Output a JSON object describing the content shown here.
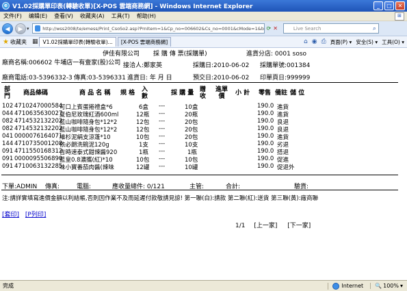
{
  "window": {
    "title": "V1.02採購單印表(轉驗收單)[X-POS 雲端商務網] - Windows Internet Explorer",
    "minimize": "_",
    "maximize": "□",
    "close": "✕"
  },
  "menu": [
    "文件(F)",
    "编辑(E)",
    "查看(V)",
    "收藏夹(A)",
    "工具(T)",
    "帮助(H)"
  ],
  "address": {
    "url": "http://wss2008/te/emess/Print_CsoSo2.asp?PrnItem=1&Cp_no=006602&Cs_no=0001&cMode=1&bk18",
    "search_placeholder": "Live Search"
  },
  "favorites": {
    "label": "收藏夹",
    "tabs": [
      "V1.02採購單印表(轉驗收單)...",
      "[X-POS 雲端商務網]"
    ],
    "tools": [
      "頁面(P) ▾",
      "安全(S) ▾",
      "工具(O) ▾"
    ]
  },
  "doc": {
    "company": "伊佳有限公司",
    "doc_title": "採 購 傳 票(採購單)",
    "branch": "進貨分店: 0001 soso",
    "supplier": "廠商名稱:006602 牛埔店一有壹家(股)公司",
    "contact": "接洽人:鄭家英",
    "order_date": "採購日:2010-06-02",
    "order_no": "採購單號:001384",
    "phone": "廠商電話:03-5396332-3",
    "fax": "傳真:03-5396331",
    "delivery": "進貨日:   年   月   日",
    "eta": "預交日:2010-06-02",
    "print_count": "印單頁日:999999",
    "headers": {
      "dept": "部門",
      "barcode": "商品條碼",
      "name": "商 品 名 稱",
      "spec": "規 格",
      "in_qty": "入數",
      "order_qty": "採 購 量",
      "gift": "贈收",
      "price": "進單價",
      "subtotal": "小 計",
      "retail": "零售",
      "remark": "備註",
      "storage": "儲 位"
    },
    "rows": [
      {
        "dept": "102",
        "barcode": "4710247000584",
        "name": "可口上賓蛋捲禮盒*6",
        "in": "6盒",
        "dash": "---",
        "qty": "10盒",
        "retail": "190.0",
        "remark": "進貨"
      },
      {
        "dept": "044",
        "barcode": "4710635630027",
        "name": "夏伯尼玫瑰紅酒600ml",
        "in": "12瓶",
        "dash": "---",
        "qty": "20瓶",
        "retail": "190.0",
        "remark": "進貨"
      },
      {
        "dept": "082",
        "barcode": "4714532132202",
        "name": "藍山咖啡隨身包*12*2",
        "in": "12包",
        "dash": "---",
        "qty": "20包",
        "retail": "190.0",
        "remark": "良退"
      },
      {
        "dept": "082",
        "barcode": "4714532132202",
        "name": "藍山咖啡隨身包*12*2",
        "in": "12包",
        "dash": "---",
        "qty": "20包",
        "retail": "190.0",
        "remark": "良退"
      },
      {
        "dept": "041",
        "barcode": "0000076164071",
        "name": "維杉泥絹支涼蓬*10",
        "in": "10包",
        "dash": "---",
        "qty": "20包",
        "retail": "190.0",
        "remark": "進貨"
      },
      {
        "dept": "144",
        "barcode": "4710735001208",
        "name": "依必朗洗碗泥120g",
        "in": "1支",
        "dash": "---",
        "qty": "10支",
        "retail": "190.0",
        "remark": "劣退"
      },
      {
        "dept": "091",
        "barcode": "4711550168312",
        "name": "吉時速泰式甜辣醬920",
        "in": "1瓶",
        "dash": "---",
        "qty": "1瓶",
        "retail": "190.0",
        "remark": "搭退"
      },
      {
        "dept": "091",
        "barcode": "0000095506890",
        "name": "藍皇0.8濃攜(紅)*10",
        "in": "10包",
        "dash": "---",
        "qty": "10包",
        "retail": "190.0",
        "remark": "促進"
      },
      {
        "dept": "091",
        "barcode": "4710063132285",
        "name": "味小寶番茄肉醬(辣味",
        "in": "12罐",
        "dash": "---",
        "qty": "10罐",
        "retail": "190.0",
        "remark": "促退外"
      }
    ],
    "footer": {
      "order_by": "下單:ADMIN",
      "fax": "傳真:",
      "pc": "電腦:",
      "receive_count": "應收量總件: 0/121",
      "supervisor": "主管:",
      "total": "合計:",
      "verifier": "驗貨:"
    },
    "note": "注:請詳實填寫進價金額以利結帳,否則因作業不及而延遲付款敬請見諒! 第一聯(白):請款 第二聯(紅):送貨 第三聯(黃):廠商聯"
  },
  "actions": {
    "cover": "[套印]",
    "print": "[P列印]",
    "page_info": "1/1",
    "prev": "[上一家]",
    "next": "[下一家]"
  },
  "status": {
    "done": "完成",
    "zone": "Internet",
    "zoom": "100%"
  }
}
